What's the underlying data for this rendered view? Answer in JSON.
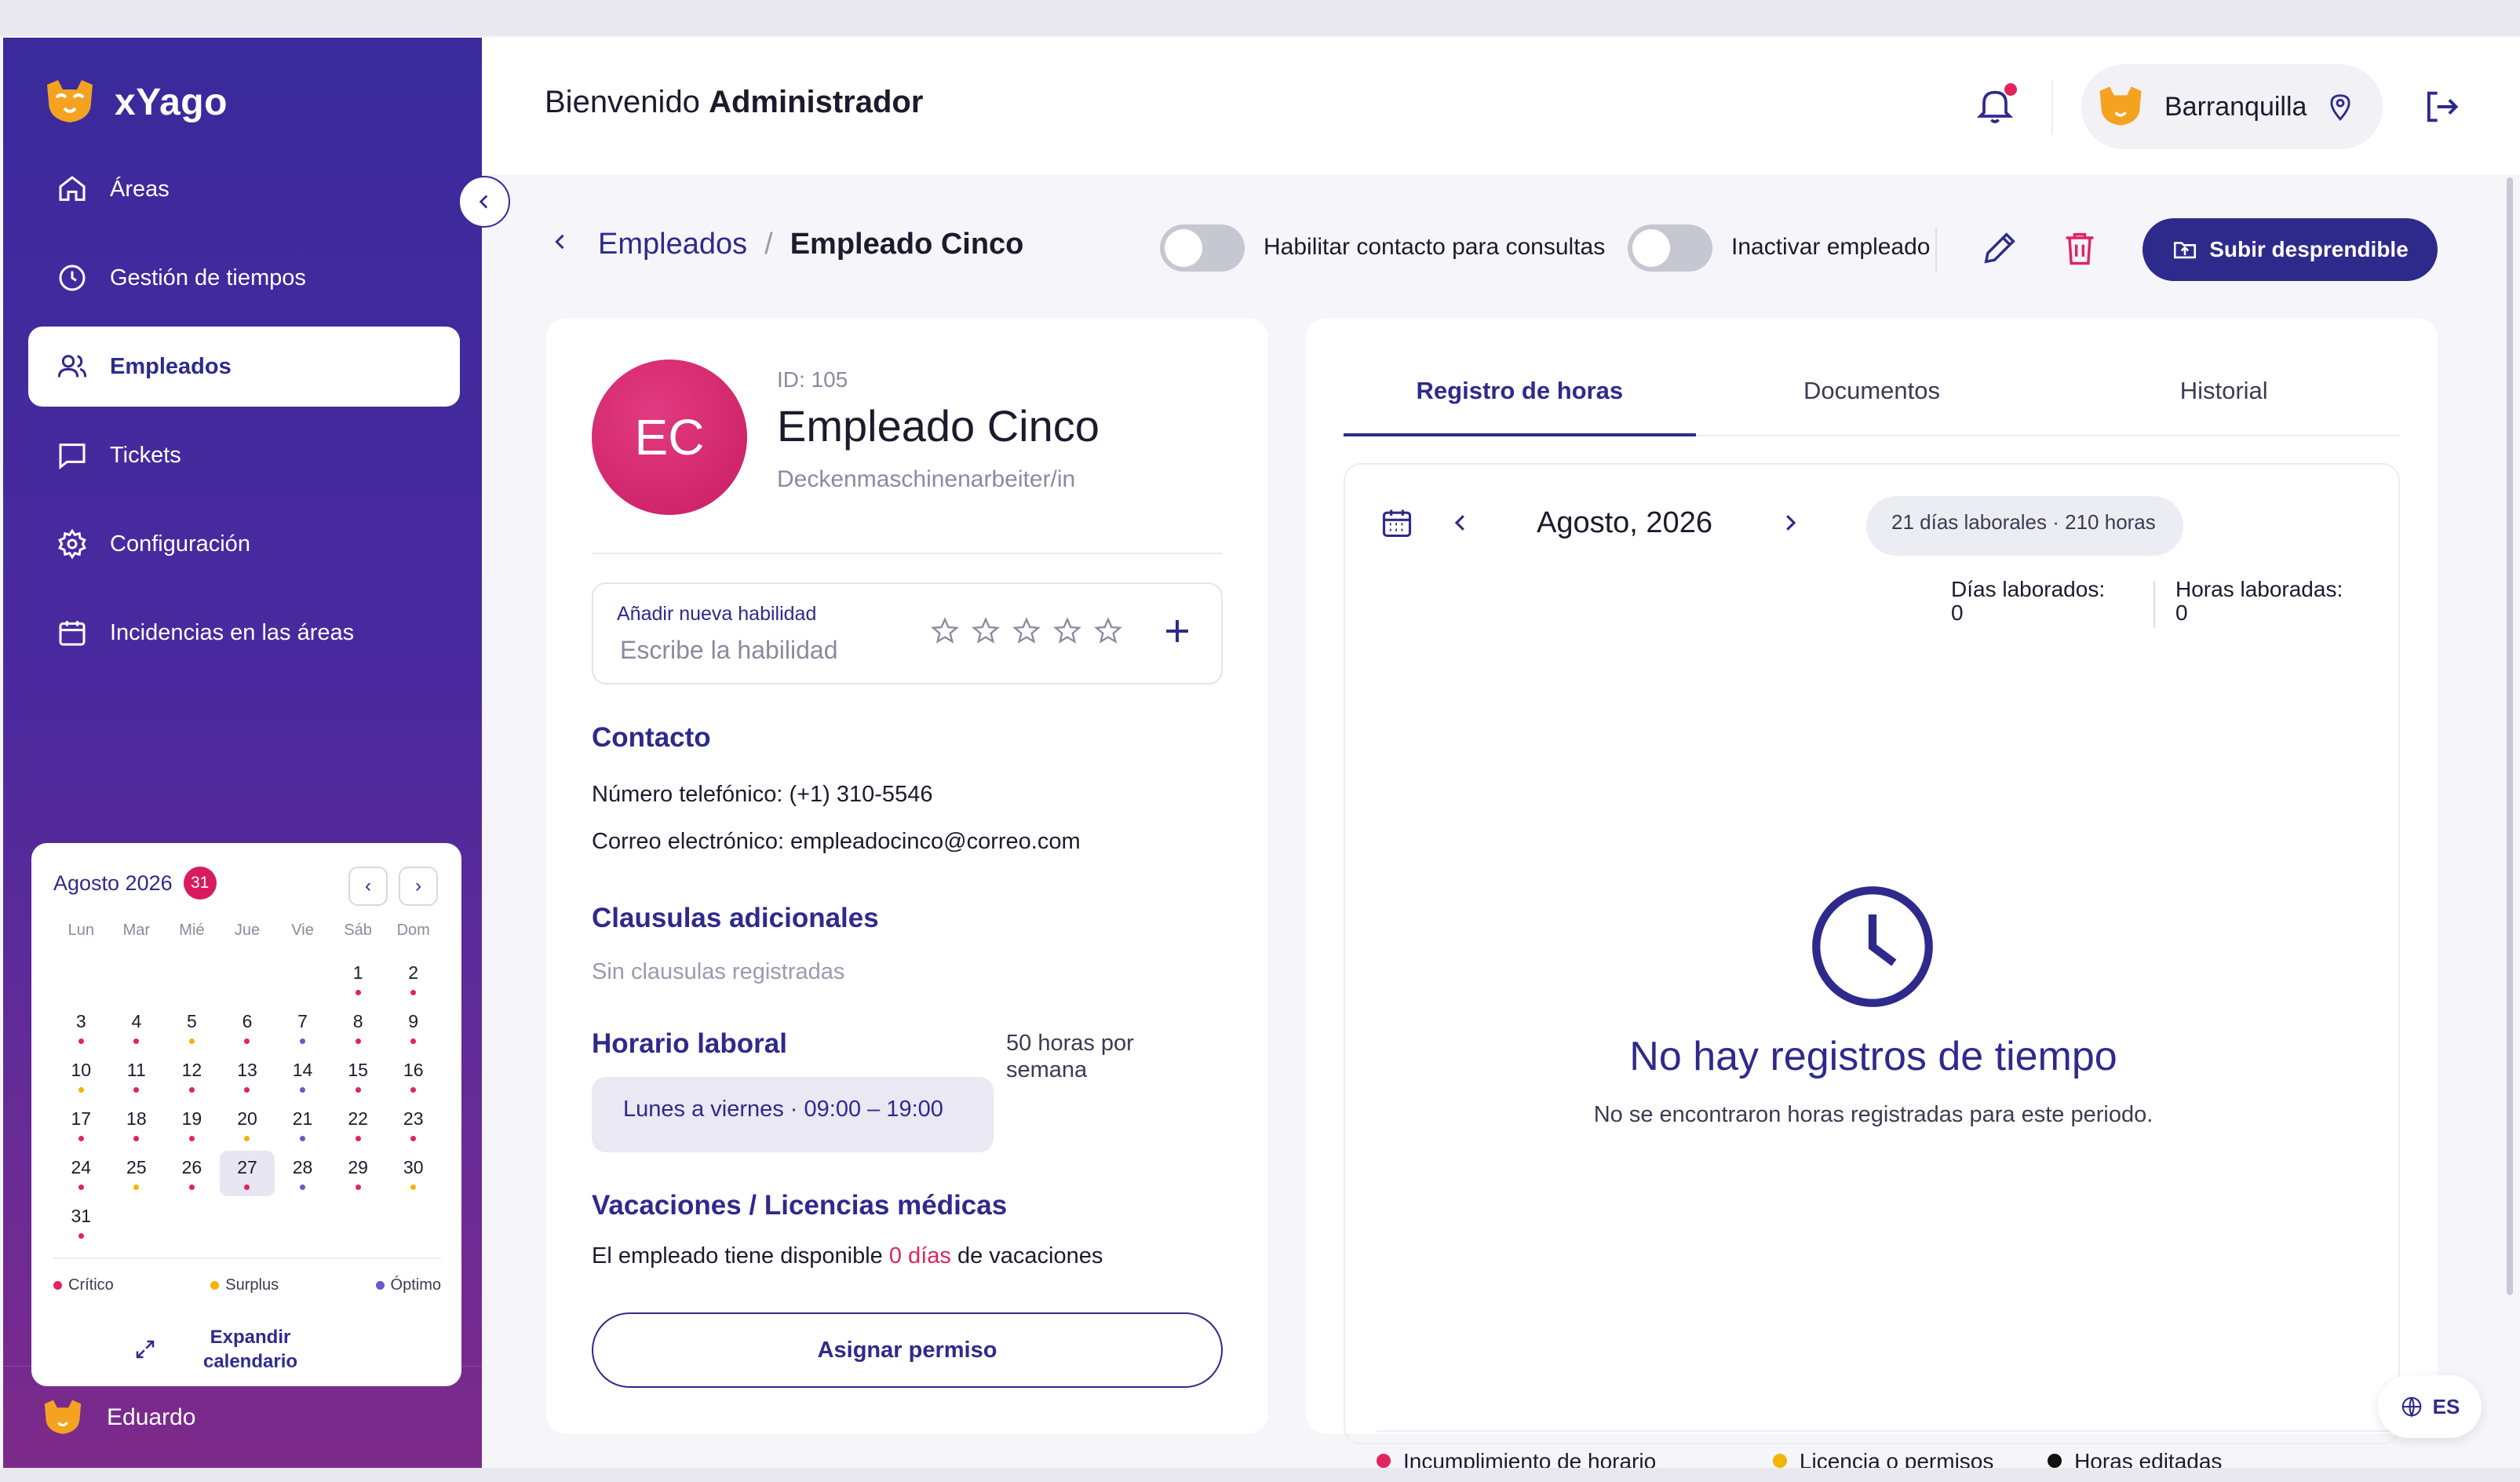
{
  "app": {
    "name": "xYago",
    "brand_color": "#2e2a8c",
    "accent_color": "#e0245e"
  },
  "sidebar": {
    "items": [
      {
        "label": "Áreas",
        "icon": "home-icon"
      },
      {
        "label": "Gestión de tiempos",
        "icon": "clock-icon"
      },
      {
        "label": "Empleados",
        "icon": "users-icon",
        "active": true
      },
      {
        "label": "Tickets",
        "icon": "message-icon"
      },
      {
        "label": "Configuración",
        "icon": "gear-icon"
      },
      {
        "label": "Incidencias en las áreas",
        "icon": "calendar-icon"
      }
    ],
    "user_name": "Eduardo"
  },
  "mini_calendar": {
    "month_label": "Agosto 2026",
    "badge": "31",
    "weekdays": [
      "Lun",
      "Mar",
      "Mié",
      "Jue",
      "Vie",
      "Sáb",
      "Dom"
    ],
    "leading_blanks": 5,
    "today": "27",
    "days": [
      {
        "d": "1",
        "s": "c"
      },
      {
        "d": "2",
        "s": "c"
      },
      {
        "d": "3",
        "s": "c"
      },
      {
        "d": "4",
        "s": "c"
      },
      {
        "d": "5",
        "s": "s"
      },
      {
        "d": "6",
        "s": "c"
      },
      {
        "d": "7",
        "s": "o"
      },
      {
        "d": "8",
        "s": "c"
      },
      {
        "d": "9",
        "s": "c"
      },
      {
        "d": "10",
        "s": "s"
      },
      {
        "d": "11",
        "s": "c"
      },
      {
        "d": "12",
        "s": "c"
      },
      {
        "d": "13",
        "s": "c"
      },
      {
        "d": "14",
        "s": "o"
      },
      {
        "d": "15",
        "s": "c"
      },
      {
        "d": "16",
        "s": "c"
      },
      {
        "d": "17",
        "s": "c"
      },
      {
        "d": "18",
        "s": "c"
      },
      {
        "d": "19",
        "s": "c"
      },
      {
        "d": "20",
        "s": "s"
      },
      {
        "d": "21",
        "s": "o"
      },
      {
        "d": "22",
        "s": "c"
      },
      {
        "d": "23",
        "s": "c"
      },
      {
        "d": "24",
        "s": "c"
      },
      {
        "d": "25",
        "s": "s"
      },
      {
        "d": "26",
        "s": "c"
      },
      {
        "d": "27",
        "s": "c"
      },
      {
        "d": "28",
        "s": "o"
      },
      {
        "d": "29",
        "s": "c"
      },
      {
        "d": "30",
        "s": "s"
      },
      {
        "d": "31",
        "s": "c"
      }
    ],
    "legend": {
      "critical": "Crítico",
      "surplus": "Surplus",
      "optimal": "Óptimo"
    },
    "expand_label": "Expandir calendario"
  },
  "header": {
    "welcome_prefix": "Bienvenido",
    "welcome_role": "Administrador",
    "location": "Barranquilla"
  },
  "breadcrumb": {
    "parent": "Empleados",
    "separator": "/",
    "current": "Empleado Cinco"
  },
  "actions": {
    "contact_toggle_label": "Habilitar contacto para consultas",
    "inactivate_toggle_label": "Inactivar empleado",
    "upload_label": "Subir desprendible"
  },
  "employee": {
    "initials": "EC",
    "id_label": "ID: 105",
    "name": "Empleado Cinco",
    "role": "Deckenmaschinenarbeiter/in",
    "skill_label": "Añadir nueva habilidad",
    "skill_placeholder": "Escribe la habilidad",
    "contact_title": "Contacto",
    "phone_line": "Número telefónico: (+1) 310-5546",
    "email_line": "Correo electrónico: empleadocinco@correo.com",
    "clauses_title": "Clausulas adicionales",
    "clauses_empty": "Sin clausulas registradas",
    "schedule_title": "Horario laboral",
    "schedule_value": "Lunes a viernes · 09:00 – 19:00",
    "schedule_hours": "50 horas por semana",
    "vacations_title": "Vacaciones / Licencias médicas",
    "vacation_prefix": "El empleado tiene disponible",
    "vacation_days": "0 días",
    "vacation_suffix": "de vacaciones",
    "assign_label": "Asignar permiso"
  },
  "records": {
    "tabs": [
      "Registro de horas",
      "Documentos",
      "Historial"
    ],
    "month": "Agosto, 2026",
    "summary": "21 días laborales · 210 horas",
    "days_worked_label": "Días laborados:",
    "days_worked_value": "0",
    "hours_worked_label": "Horas laboradas:",
    "hours_worked_value": "0",
    "empty_title": "No hay registros de tiempo",
    "empty_sub": "No se encontraron horas registradas para este periodo.",
    "legend": [
      "Incumplimiento de horario laboral",
      "Licencia o permisos",
      "Horas editadas"
    ]
  },
  "language": "ES"
}
